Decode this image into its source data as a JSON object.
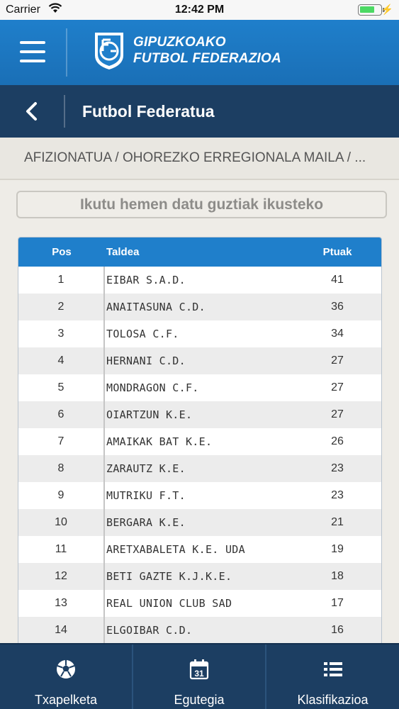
{
  "status_bar": {
    "carrier": "Carrier",
    "time": "12:42 PM",
    "battery_level": 0.75
  },
  "header": {
    "logo_line1": "GIPUZKOAKO",
    "logo_line2": "FUTBOL FEDERAZIOA"
  },
  "sub_header": {
    "title": "Futbol Federatua"
  },
  "breadcrumb": "AFIZIONATUA / OHOREZKO ERREGIONALA MAILA / ...",
  "info_button": "Ikutu hemen datu guztiak ikusteko",
  "table": {
    "headers": {
      "pos": "Pos",
      "team": "Taldea",
      "points": "Ptuak"
    },
    "rows": [
      {
        "pos": "1",
        "team": "EIBAR S.A.D.",
        "points": "41"
      },
      {
        "pos": "2",
        "team": "ANAITASUNA C.D.",
        "points": "36"
      },
      {
        "pos": "3",
        "team": "TOLOSA C.F.",
        "points": "34"
      },
      {
        "pos": "4",
        "team": "HERNANI C.D.",
        "points": "27"
      },
      {
        "pos": "5",
        "team": "MONDRAGON C.F.",
        "points": "27"
      },
      {
        "pos": "6",
        "team": "OIARTZUN K.E.",
        "points": "27"
      },
      {
        "pos": "7",
        "team": "AMAIKAK BAT K.E.",
        "points": "26"
      },
      {
        "pos": "8",
        "team": "ZARAUTZ K.E.",
        "points": "23"
      },
      {
        "pos": "9",
        "team": "MUTRIKU F.T.",
        "points": "23"
      },
      {
        "pos": "10",
        "team": "BERGARA K.E.",
        "points": "21"
      },
      {
        "pos": "11",
        "team": "ARETXABALETA K.E. UDA",
        "points": "19"
      },
      {
        "pos": "12",
        "team": "BETI GAZTE K.J.K.E.",
        "points": "18"
      },
      {
        "pos": "13",
        "team": "REAL UNION CLUB SAD",
        "points": "17"
      },
      {
        "pos": "14",
        "team": "ELGOIBAR C.D.",
        "points": "16"
      }
    ]
  },
  "tabs": [
    {
      "label": "Txapelketa",
      "icon": "soccer-ball-icon"
    },
    {
      "label": "Egutegia",
      "icon": "calendar-icon",
      "calendar_day": "31"
    },
    {
      "label": "Klasifikazioa",
      "icon": "list-icon"
    }
  ],
  "colors": {
    "primary": "#1f7fcb",
    "dark": "#1c3e62",
    "background": "#eeece7"
  }
}
